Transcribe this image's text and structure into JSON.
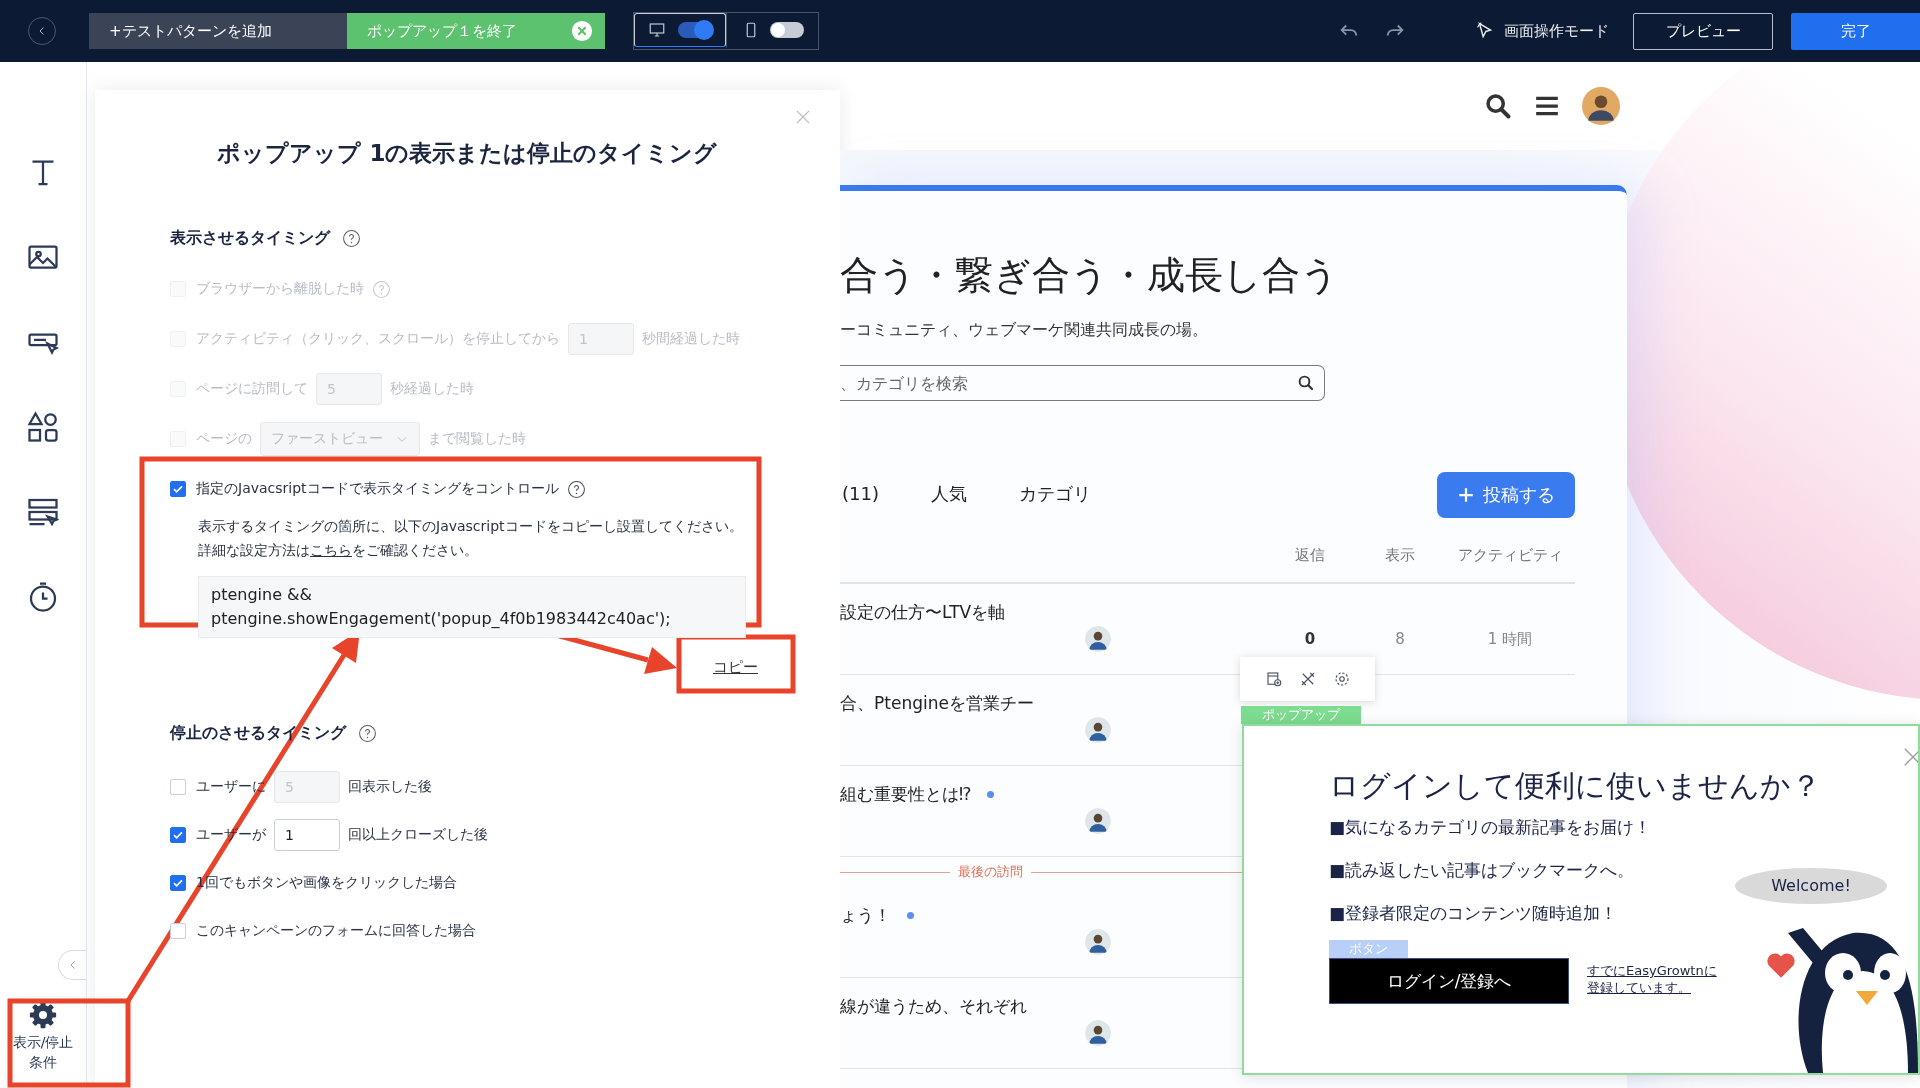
{
  "topbar": {
    "tabs": [
      {
        "label": "+テストパターンを追加",
        "selected": false
      },
      {
        "label": "ポップアップ１を終了",
        "selected": true
      }
    ],
    "devices": [
      {
        "kind": "desktop",
        "on": true,
        "selected": true
      },
      {
        "kind": "mobile",
        "on": false,
        "selected": false
      }
    ],
    "mode": "画面操作モード",
    "preview": "プレビュー",
    "done": "完了"
  },
  "sidebar": {
    "tools": [
      {
        "kind": "text"
      },
      {
        "kind": "image"
      },
      {
        "kind": "button"
      },
      {
        "kind": "shapes"
      },
      {
        "kind": "form"
      },
      {
        "kind": "timer"
      }
    ],
    "conditions": "表示/停止条件"
  },
  "modal": {
    "title": "ポップアップ 1の表示または停止のタイミング",
    "sections": [
      {
        "heading": "表示させるタイミング",
        "options": [
          {
            "checked": false,
            "disabled": true,
            "parts": [
              {
                "kind": "text",
                "text": "ブラウザーから離脱した時"
              },
              {
                "kind": "help"
              }
            ]
          },
          {
            "checked": false,
            "disabled": true,
            "parts": [
              {
                "kind": "text",
                "text": "アクティビティ（クリック、スクロール）を停止してから"
              },
              {
                "kind": "input",
                "value": "1",
                "disabled": true
              },
              {
                "kind": "text",
                "text": "秒間経過した時"
              }
            ]
          },
          {
            "checked": false,
            "disabled": true,
            "parts": [
              {
                "kind": "text",
                "text": "ページに訪問して"
              },
              {
                "kind": "input",
                "value": "5",
                "disabled": true
              },
              {
                "kind": "text",
                "text": "秒経過した時"
              }
            ]
          },
          {
            "checked": false,
            "disabled": true,
            "parts": [
              {
                "kind": "text",
                "text": "ページの"
              },
              {
                "kind": "select",
                "value": "ファーストビュー",
                "disabled": true
              },
              {
                "kind": "text",
                "text": "まで閲覧した時"
              }
            ]
          },
          {
            "checked": true,
            "disabled": false,
            "parts": [
              {
                "kind": "text",
                "text": "指定のJavacsriptコードで表示タイミングをコントロール"
              },
              {
                "kind": "help"
              }
            ],
            "description": {
              "before": "表示するタイミングの箇所に、以下のJavascriptコードをコピーし設置してください。詳細な設定方法は",
              "link": "こちら",
              "after": "をご確認ください。"
            },
            "code": "ptengine &&\nptengine.showEngagement('popup_4f0b1983442c40ac');",
            "copy": "コピー"
          }
        ]
      },
      {
        "heading": "停止のさせるタイミング",
        "options": [
          {
            "checked": false,
            "disabled": false,
            "parts": [
              {
                "kind": "text",
                "text": "ユーザーに"
              },
              {
                "kind": "input",
                "value": "5",
                "disabled": true
              },
              {
                "kind": "text",
                "text": "回表示した後"
              }
            ]
          },
          {
            "checked": true,
            "disabled": false,
            "parts": [
              {
                "kind": "text",
                "text": "ユーザーが"
              },
              {
                "kind": "input",
                "value": "1",
                "disabled": false
              },
              {
                "kind": "text",
                "text": "回以上クローズした後"
              }
            ]
          },
          {
            "checked": true,
            "disabled": false,
            "parts": [
              {
                "kind": "text",
                "text": "1回でもボタンや画像をクリックした場合"
              }
            ]
          },
          {
            "checked": false,
            "disabled": false,
            "parts": [
              {
                "kind": "text",
                "text": "このキャンペーンのフォームに回答した場合"
              }
            ]
          }
        ]
      }
    ]
  },
  "page": {
    "title": "合う・繋ぎ合う・成長し合う",
    "subtitle": "ーコミュニティ、ウェブマーケ関連共同成長の場。",
    "search_placeholder": "、カテゴリを検索",
    "tabs": [
      {
        "label": "(11)",
        "selected": false
      },
      {
        "label": "人気",
        "selected": false
      },
      {
        "label": "カテゴリ",
        "selected": false
      }
    ],
    "post_button": "投稿する",
    "columns": [
      "返信",
      "表示",
      "アクティビティ"
    ],
    "topics": [
      {
        "kind": "topic",
        "title": "設定の仕方〜LTVを軸",
        "unread": false,
        "replies": "0",
        "views": "8",
        "activity": "1 時間"
      },
      {
        "kind": "topic",
        "title": "合、Ptengineを営業チー",
        "unread": false
      },
      {
        "kind": "topic",
        "title": "組む重要性とは⁉",
        "unread": true
      },
      {
        "kind": "divider",
        "label": "最後の訪問"
      },
      {
        "kind": "topic",
        "title": "ょう！",
        "unread": true
      },
      {
        "kind": "topic",
        "title": "線が違うため、それぞれ",
        "unread": false
      }
    ]
  },
  "popup": {
    "tag": "ポップアップ",
    "title": "ログインして便利に使いませんか？",
    "bullets": [
      "■気になるカテゴリの最新記事をお届け！",
      "■読み返したい記事はブックマークへ。",
      "■登録者限定のコンテンツ随時追加！"
    ],
    "button_tag": "ボタン",
    "button": "ログイン/登録へ",
    "link": "すでにEasyGrowtnに登録しています。",
    "bubble": "Welcome!"
  }
}
